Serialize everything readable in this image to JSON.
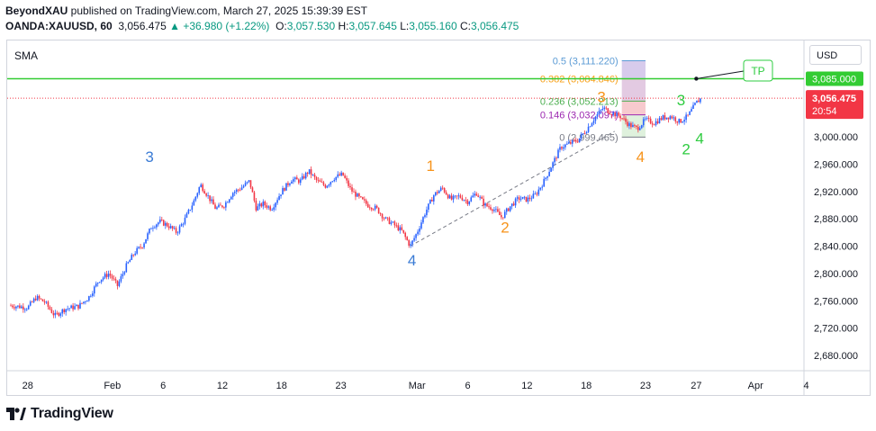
{
  "header": {
    "author": "BeyondXAU",
    "published_text": " published on TradingView.com, March 27, 2025 15:39:39 EST",
    "symbol": "OANDA:XAUUSD, 60",
    "last": "3,056.475",
    "change": "+36.980 (+1.22%)",
    "open_label": "O:",
    "open": "3,057.530",
    "high_label": "H:",
    "high": "3,057.645",
    "low_label": "L:",
    "low": "3,055.160",
    "close_label": "C:",
    "close": "3,056.475"
  },
  "indicator_label": "SMA",
  "currency_button": "USD",
  "price_axis": {
    "ticks": [
      "3,000.000",
      "2,960.000",
      "2,920.000",
      "2,880.000",
      "2,840.000",
      "2,800.000",
      "2,760.000",
      "2,720.000",
      "2,680.000"
    ],
    "tick_values": [
      3000,
      2960,
      2920,
      2880,
      2840,
      2800,
      2760,
      2720,
      2680
    ],
    "tp_level_label": "3,085.000",
    "tp_level_value": 3085,
    "current_price_label": "3,056.475",
    "current_price_value": 3056.475,
    "countdown": "20:54"
  },
  "time_axis": {
    "labels": [
      "28",
      "Feb",
      "6",
      "12",
      "18",
      "23",
      "Mar",
      "6",
      "12",
      "18",
      "23",
      "27",
      "Apr",
      "4"
    ],
    "label_index": [
      1,
      6,
      9,
      12.5,
      16,
      19.5,
      24,
      27,
      30.5,
      34,
      37.5,
      40.5,
      44,
      47
    ]
  },
  "fib_levels": [
    {
      "label": "0.5 (3,111.220)",
      "value": 3111.22,
      "color": "#5b9bd5"
    },
    {
      "label": "0.382 (3,084.846)",
      "value": 3084.846,
      "color": "#f7a21b"
    },
    {
      "label": "0.236 (3,052.213)",
      "value": 3052.213,
      "color": "#4caf50"
    },
    {
      "label": "0.146 (3,032.097)",
      "value": 3032.097,
      "color": "#9c27b0"
    },
    {
      "label": "0 (2,999.465)",
      "value": 2999.465,
      "color": "#787b86"
    }
  ],
  "wave_labels": [
    {
      "text": "3",
      "color": "#3a7bd5",
      "idx": 8.2,
      "price": 2963
    },
    {
      "text": "4",
      "color": "#3a7bd5",
      "idx": 23.7,
      "price": 2812
    },
    {
      "text": "1",
      "color": "#f7931a",
      "idx": 24.8,
      "price": 2950
    },
    {
      "text": "2",
      "color": "#f7931a",
      "idx": 29.2,
      "price": 2860
    },
    {
      "text": "3",
      "color": "#f7931a",
      "idx": 34.9,
      "price": 3051
    },
    {
      "text": "4",
      "color": "#f7931a",
      "idx": 37.2,
      "price": 2963
    },
    {
      "text": "3",
      "color": "#2ecc40",
      "idx": 39.6,
      "price": 3046
    },
    {
      "text": "2",
      "color": "#2ecc40",
      "idx": 39.9,
      "price": 2974
    },
    {
      "text": "4",
      "color": "#2ecc40",
      "idx": 40.7,
      "price": 2990
    }
  ],
  "tp_label": "TP",
  "brand": "TradingView",
  "colors": {
    "up": "#2962ff",
    "down": "#f23645",
    "tp_line": "#33cc33",
    "price_line": "#f23645"
  },
  "chart_data": {
    "type": "candlestick",
    "symbol": "OANDA:XAUUSD",
    "timeframe": "60",
    "x_labels": [
      "28",
      "Feb",
      "6",
      "12",
      "18",
      "23",
      "Mar",
      "6",
      "12",
      "18",
      "23",
      "27",
      "Apr",
      "4"
    ],
    "ylim": [
      2650,
      3125
    ],
    "close_path": [
      [
        0,
        2753
      ],
      [
        1,
        2750
      ],
      [
        1.5,
        2765
      ],
      [
        2,
        2758
      ],
      [
        2.6,
        2738
      ],
      [
        3.2,
        2748
      ],
      [
        4,
        2752
      ],
      [
        4.6,
        2765
      ],
      [
        5.2,
        2790
      ],
      [
        5.8,
        2800
      ],
      [
        6.3,
        2782
      ],
      [
        6.8,
        2810
      ],
      [
        7.3,
        2830
      ],
      [
        7.8,
        2842
      ],
      [
        8.3,
        2868
      ],
      [
        8.8,
        2876
      ],
      [
        9.3,
        2870
      ],
      [
        9.8,
        2860
      ],
      [
        10.3,
        2880
      ],
      [
        10.8,
        2905
      ],
      [
        11.2,
        2930
      ],
      [
        11.6,
        2915
      ],
      [
        12.1,
        2895
      ],
      [
        12.6,
        2900
      ],
      [
        13.1,
        2918
      ],
      [
        13.6,
        2925
      ],
      [
        14.1,
        2935
      ],
      [
        14.5,
        2895
      ],
      [
        14.9,
        2902
      ],
      [
        15.4,
        2895
      ],
      [
        16,
        2920
      ],
      [
        16.6,
        2938
      ],
      [
        17.1,
        2935
      ],
      [
        17.6,
        2950
      ],
      [
        18.1,
        2935
      ],
      [
        18.6,
        2928
      ],
      [
        19.1,
        2940
      ],
      [
        19.6,
        2945
      ],
      [
        20.1,
        2922
      ],
      [
        20.6,
        2910
      ],
      [
        21.1,
        2900
      ],
      [
        21.6,
        2895
      ],
      [
        22.1,
        2880
      ],
      [
        22.6,
        2872
      ],
      [
        23.1,
        2862
      ],
      [
        23.6,
        2840
      ],
      [
        24,
        2860
      ],
      [
        24.5,
        2890
      ],
      [
        25,
        2915
      ],
      [
        25.5,
        2925
      ],
      [
        26,
        2908
      ],
      [
        26.5,
        2913
      ],
      [
        27,
        2905
      ],
      [
        27.5,
        2918
      ],
      [
        28,
        2900
      ],
      [
        28.5,
        2895
      ],
      [
        29,
        2882
      ],
      [
        29.5,
        2898
      ],
      [
        30,
        2910
      ],
      [
        30.5,
        2908
      ],
      [
        31,
        2915
      ],
      [
        31.5,
        2935
      ],
      [
        32,
        2960
      ],
      [
        32.5,
        2985
      ],
      [
        33,
        2990
      ],
      [
        33.5,
        2995
      ],
      [
        34,
        3010
      ],
      [
        34.5,
        3028
      ],
      [
        35,
        3042
      ],
      [
        35.5,
        3035
      ],
      [
        36,
        3030
      ],
      [
        36.5,
        3018
      ],
      [
        37,
        3012
      ],
      [
        37.5,
        3025
      ],
      [
        38,
        3020
      ],
      [
        38.5,
        3028
      ],
      [
        39,
        3030
      ],
      [
        39.5,
        3022
      ],
      [
        40,
        3030
      ],
      [
        40.5,
        3050
      ],
      [
        40.8,
        3056.5
      ]
    ],
    "tp": 3085,
    "last_price": 3056.475
  }
}
